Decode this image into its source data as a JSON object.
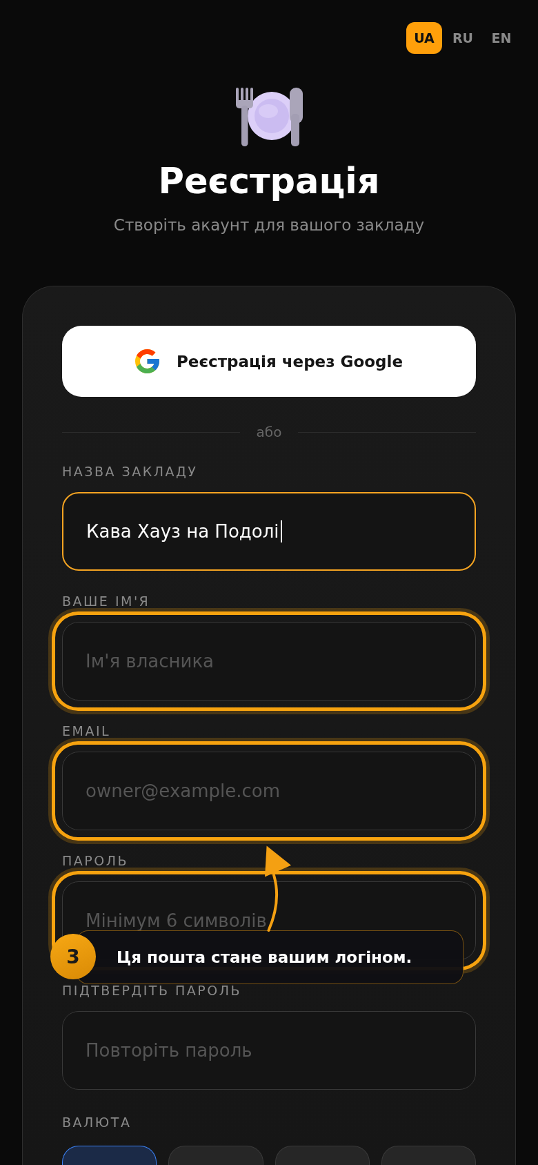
{
  "languages": [
    {
      "label": "UA",
      "selected": true
    },
    {
      "label": "RU",
      "selected": false
    },
    {
      "label": "EN",
      "selected": false
    }
  ],
  "header": {
    "title": "Реєстрація",
    "subtitle": "Створіть акаунт для вашого закладу"
  },
  "form": {
    "google_button": "Реєстрація через Google",
    "divider": "або",
    "fields": [
      {
        "label": "НАЗВА ЗАКЛАДУ",
        "value": "Кава Хауз на Подолі",
        "focused": true,
        "highlighted": false
      },
      {
        "label": "ВАШЕ ІМ'Я",
        "placeholder": "Ім'я власника",
        "focused": false,
        "highlighted": true
      },
      {
        "label": "EMAIL",
        "placeholder": "owner@example.com",
        "focused": false,
        "highlighted": true
      },
      {
        "label": "ПАРОЛЬ",
        "placeholder": "Мінімум 6 символів",
        "focused": false,
        "highlighted": true
      },
      {
        "label": "ПІДТВЕРДІТЬ ПАРОЛЬ",
        "placeholder": "Повторіть пароль",
        "focused": false,
        "highlighted": false
      }
    ],
    "currency": {
      "label": "ВАЛЮТА",
      "options": [
        {
          "selected": true
        },
        {
          "selected": false
        },
        {
          "selected": false
        },
        {
          "selected": false
        }
      ]
    }
  },
  "tour_tip": {
    "step": "3",
    "text": "Ця пошта стане вашим логіном."
  }
}
